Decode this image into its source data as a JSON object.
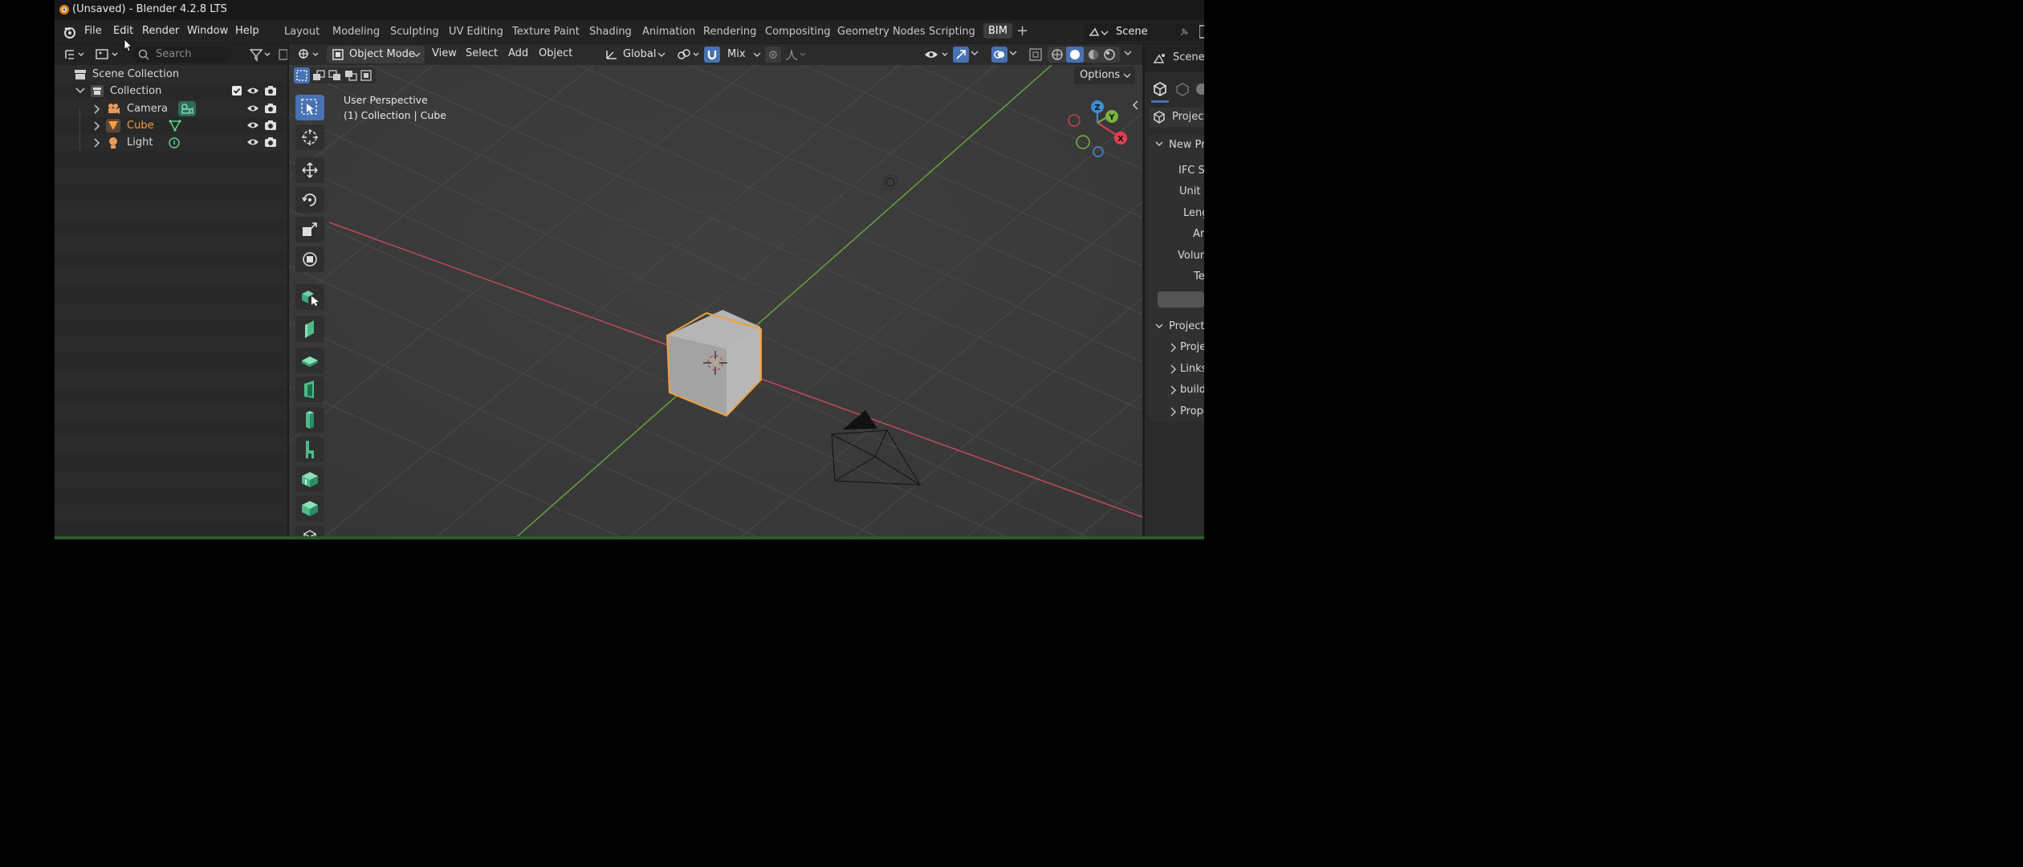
{
  "window": {
    "title": "(Unsaved) - Blender 4.2.8 LTS"
  },
  "menu": {
    "file": "File",
    "edit": "Edit",
    "render": "Render",
    "window": "Window",
    "help": "Help"
  },
  "workspaces": [
    "Layout",
    "Modeling",
    "Sculpting",
    "UV Editing",
    "Texture Paint",
    "Shading",
    "Animation",
    "Rendering",
    "Compositing",
    "Geometry Nodes",
    "Scripting",
    "BIM"
  ],
  "active_workspace": "BIM",
  "scene_selector": {
    "name": "Scene"
  },
  "outliner": {
    "search_placeholder": "Search",
    "scene_collection": "Scene Collection",
    "collection": "Collection",
    "items": [
      {
        "label": "Camera"
      },
      {
        "label": "Cube",
        "selected": true
      },
      {
        "label": "Light"
      }
    ]
  },
  "viewport": {
    "mode": "Object Mode",
    "menus": {
      "view": "View",
      "select": "Select",
      "add": "Add",
      "object": "Object"
    },
    "orientation": "Global",
    "snap_mode": "Mix",
    "options": "Options",
    "overlay_line1": "User Perspective",
    "overlay_line2": "(1) Collection | Cube",
    "gizmo": {
      "x": "X",
      "y": "Y",
      "z": "Z"
    }
  },
  "properties": {
    "scene": "Scene",
    "project": "Project",
    "new_project": "New Pro",
    "fields": [
      "IFC S",
      "Unit S",
      "Leng",
      "Ar",
      "Volum",
      "Te"
    ],
    "project_section": "Project S",
    "sub_items": [
      "Proje",
      "Links",
      "buildi",
      "Prope"
    ]
  },
  "colors": {
    "selected": "#f0a040",
    "accent": "#4772b3",
    "x_axis": "#e0404f",
    "y_axis": "#7ab240",
    "z_axis": "#3a8fd8"
  }
}
